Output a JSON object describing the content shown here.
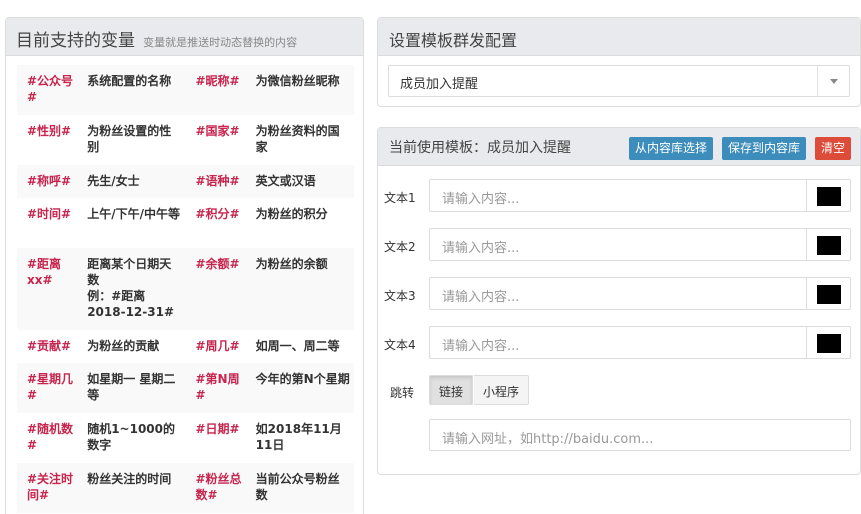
{
  "left": {
    "title": "目前支持的变量",
    "subtitle": "变量就是推送时动态替换的内容",
    "rows": [
      {
        "c1": "#公众号#",
        "d1": "系统配置的名称",
        "c2": "#昵称#",
        "d2": "为微信粉丝昵称"
      },
      {
        "c1": "#性别#",
        "d1": "为粉丝设置的性别",
        "c2": "#国家#",
        "d2": "为粉丝资料的国家"
      },
      {
        "c1": "#称呼#",
        "d1": "先生/女士",
        "c2": "#语种#",
        "d2": "英文或汉语"
      },
      {
        "c1": "#时间#",
        "d1": "上午/下午/中午等",
        "c2": "#积分#",
        "d2": "为粉丝的积分"
      },
      {
        "c1": "#距离xx#",
        "d1": "距离某个日期天数",
        "d1b": "例：#距离2018-12-31#",
        "c2": "#余额#",
        "d2": "为粉丝的余额"
      },
      {
        "c1": "#贡献#",
        "d1": "为粉丝的贡献",
        "c2": "#周几#",
        "d2": "如周一、周二等"
      },
      {
        "c1": "#星期几#",
        "d1": "如星期一 星期二等",
        "c2": "#第N周#",
        "d2": "今年的第N个星期"
      },
      {
        "c1": "#随机数#",
        "d1": "随机1~1000的数字",
        "c2": "#日期#",
        "d2": "如2018年11月11日"
      },
      {
        "c1": "#关注时间#",
        "d1": "粉丝关注的时间",
        "c2": "#粉丝总数#",
        "d2": "当前公众号粉丝数"
      }
    ]
  },
  "config": {
    "title": "设置模板群发配置",
    "selected": "成员加入提醒"
  },
  "template": {
    "title": "当前使用模板：成员加入提醒",
    "btn_select": "从内容库选择",
    "btn_save": "保存到内容库",
    "btn_clear": "清空",
    "colors": {
      "select": "#3c8dbc",
      "clear": "#dd4b39",
      "swatch": "#000000"
    },
    "fields": [
      {
        "label": "文本1",
        "placeholder": "请输入内容..."
      },
      {
        "label": "文本2",
        "placeholder": "请输入内容..."
      },
      {
        "label": "文本3",
        "placeholder": "请输入内容..."
      },
      {
        "label": "文本4",
        "placeholder": "请输入内容..."
      }
    ],
    "jump_label": "跳转",
    "jump_link": "链接",
    "jump_mini": "小程序",
    "url_placeholder": "请输入网址，如http://baidu.com..."
  }
}
